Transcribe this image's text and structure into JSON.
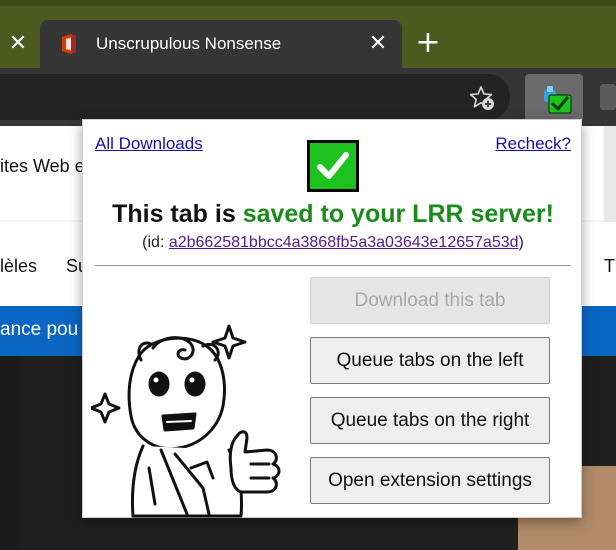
{
  "browser": {
    "tab_title": "Unscrupulous Nonsense",
    "tab_close_glyph": "✕",
    "prev_tab_close_glyph": "✕",
    "new_tab_glyph": "+",
    "icons": [
      "office-favicon-icon",
      "favorites-star-icon",
      "lrr-extension-icon",
      "close-icon",
      "new-tab-icon"
    ]
  },
  "page": {
    "bookmarks_text": "ites Web e",
    "nav_left": "lèles",
    "nav_mid": "Su",
    "nav_right": "T",
    "banner_text": "ance pou"
  },
  "popup": {
    "all_downloads_label": "All Downloads",
    "recheck_label": "Recheck?",
    "status_icon": "checkmark-icon",
    "status_prefix": "This tab is ",
    "status_highlight": "saved to your LRR server!",
    "id_prefix": "(id: ",
    "id_value": "a2b662581bbcc4a3868fb5a3a03643e12657a53d",
    "id_suffix": ")",
    "buttons": {
      "download": "Download this tab",
      "queue_left": "Queue tabs on the left",
      "queue_right": "Queue tabs on the right",
      "settings": "Open extension settings"
    },
    "mascot": "thumbs-up-mascot-illustration"
  },
  "colors": {
    "tabstrip": "#4d5a1f",
    "toolbar": "#353535",
    "link": "#1a0dab",
    "visited_link": "#551a8b",
    "success_green": "#1d8a1d",
    "check_fill": "#1ec21e",
    "banner_blue": "#0a66c2"
  }
}
